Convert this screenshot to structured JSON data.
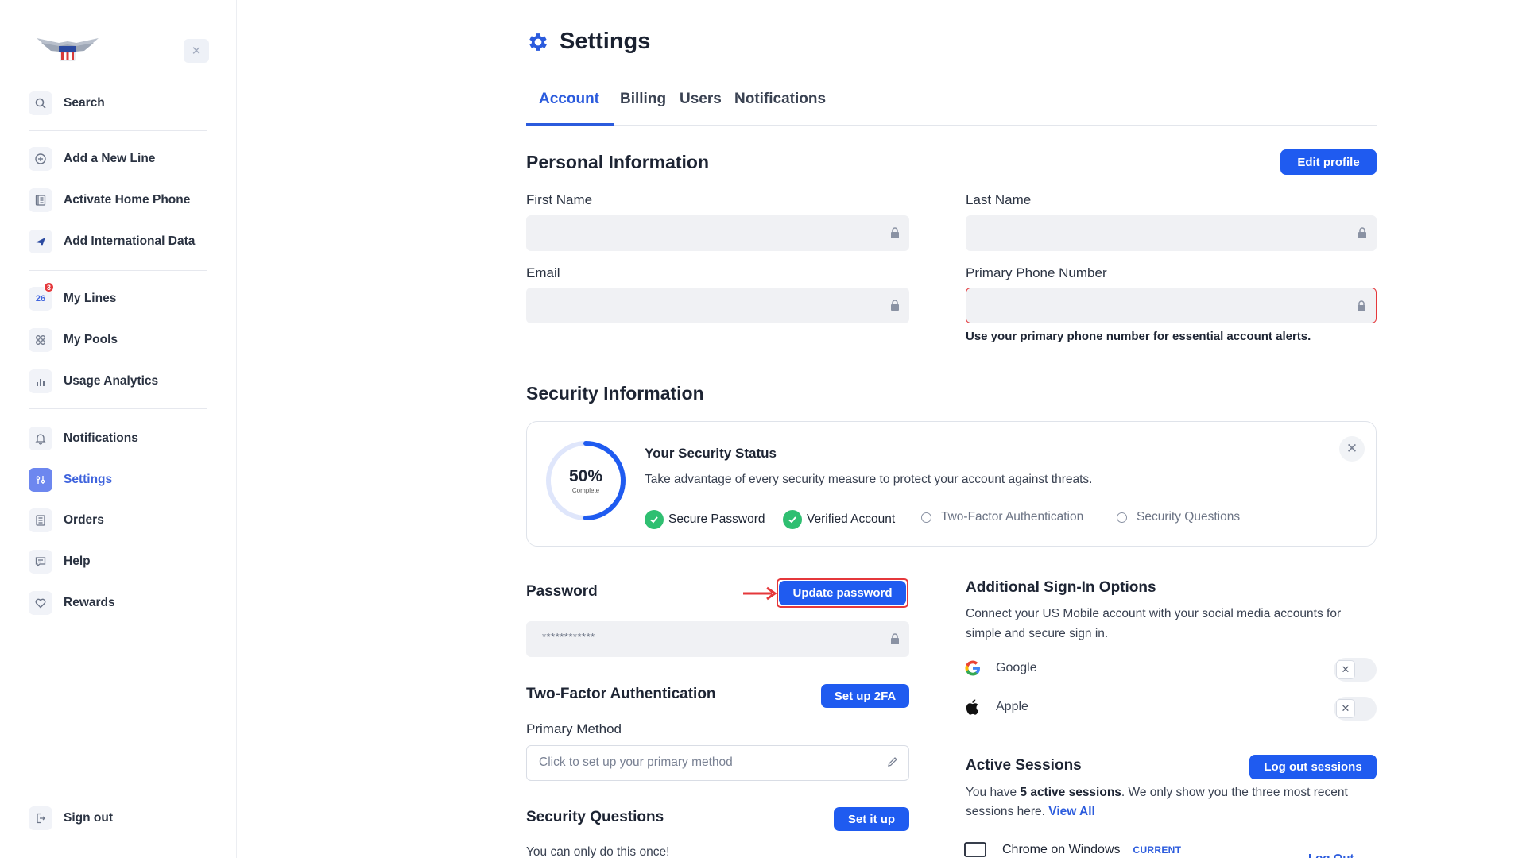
{
  "sidebar": {
    "collapse_icon": "close-icon",
    "search": {
      "label": "Search",
      "icon": "search-icon"
    },
    "items": [
      {
        "label": "Add a New Line",
        "icon": "plus-circle-icon"
      },
      {
        "label": "Activate Home Phone",
        "icon": "home-phone-icon"
      },
      {
        "label": "Add International Data",
        "icon": "plane-icon"
      },
      {
        "label": "My Lines",
        "icon": "lines-icon",
        "icon_text": "26",
        "badge": "3"
      },
      {
        "label": "My Pools",
        "icon": "pools-icon"
      },
      {
        "label": "Usage Analytics",
        "icon": "chart-icon"
      },
      {
        "label": "Notifications",
        "icon": "bell-icon"
      },
      {
        "label": "Settings",
        "icon": "settings-icon",
        "active": true
      },
      {
        "label": "Orders",
        "icon": "orders-icon"
      },
      {
        "label": "Help",
        "icon": "help-icon"
      },
      {
        "label": "Rewards",
        "icon": "heart-icon"
      }
    ],
    "signout": {
      "label": "Sign out",
      "icon": "signout-icon"
    }
  },
  "header": {
    "title": "Settings",
    "tabs": [
      "Account",
      "Billing",
      "Users",
      "Notifications"
    ],
    "active_tab": "Account"
  },
  "personal": {
    "title": "Personal Information",
    "edit_button": "Edit profile",
    "first_name_label": "First Name",
    "last_name_label": "Last Name",
    "email_label": "Email",
    "phone_label": "Primary Phone Number",
    "phone_helper": "Use your primary phone number for essential account alerts."
  },
  "security": {
    "title": "Security Information",
    "status_title": "Your Security Status",
    "status_desc": "Take advantage of every security measure to protect your account against threats.",
    "percent": "50%",
    "percent_value": 0.5,
    "percent_sub": "Complete",
    "checks": [
      {
        "label": "Secure Password",
        "done": true
      },
      {
        "label": "Verified Account",
        "done": true
      },
      {
        "label": "Two-Factor Authentication",
        "done": false
      },
      {
        "label": "Security Questions",
        "done": false
      }
    ]
  },
  "password": {
    "title": "Password",
    "button": "Update password",
    "masked_value": "************"
  },
  "twofa": {
    "title": "Two-Factor Authentication",
    "button": "Set up 2FA",
    "method_label": "Primary Method",
    "method_placeholder": "Click to set up your primary method"
  },
  "questions": {
    "title": "Security Questions",
    "button": "Set it up",
    "note": "You can only do this once!"
  },
  "signin": {
    "title": "Additional Sign-In Options",
    "desc_line1": "Connect your US Mobile account with your social media accounts for",
    "desc_line2": "simple and secure sign in.",
    "providers": [
      {
        "label": "Google",
        "icon": "google-icon",
        "connected": false
      },
      {
        "label": "Apple",
        "icon": "apple-icon",
        "connected": false
      }
    ]
  },
  "sessions": {
    "title": "Active Sessions",
    "button": "Log out sessions",
    "text_prefix": "You have ",
    "count_text": "5 active sessions",
    "text_suffix": ". We only show you the three most recent",
    "text_line2": "sessions here.",
    "view_all": "View All",
    "rows": [
      {
        "name": "Chrome on Windows",
        "badge": "CURRENT",
        "action": "Log Out"
      }
    ]
  },
  "colors": {
    "accent": "#1f5bf0",
    "success": "#2fbf71",
    "error": "#e5383b",
    "active_nav": "#6d87ef"
  }
}
